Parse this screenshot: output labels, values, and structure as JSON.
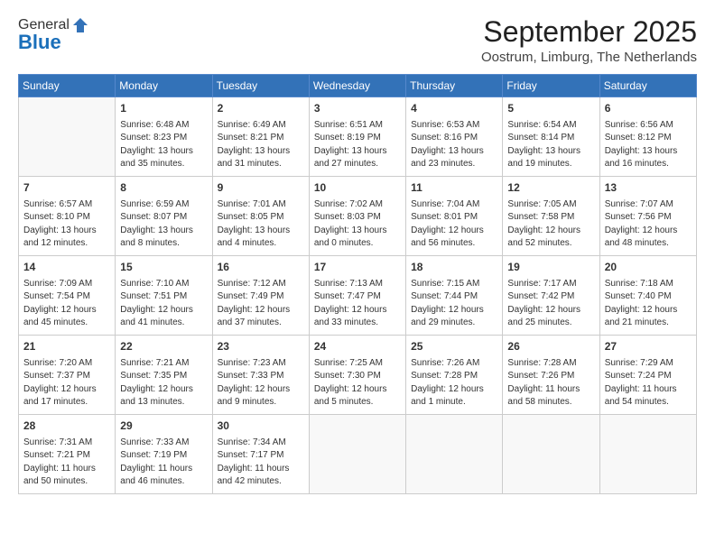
{
  "logo": {
    "general": "General",
    "blue": "Blue"
  },
  "header": {
    "month": "September 2025",
    "location": "Oostrum, Limburg, The Netherlands"
  },
  "days": [
    "Sunday",
    "Monday",
    "Tuesday",
    "Wednesday",
    "Thursday",
    "Friday",
    "Saturday"
  ],
  "weeks": [
    [
      {
        "day": "",
        "content": ""
      },
      {
        "day": "1",
        "content": "Sunrise: 6:48 AM\nSunset: 8:23 PM\nDaylight: 13 hours\nand 35 minutes."
      },
      {
        "day": "2",
        "content": "Sunrise: 6:49 AM\nSunset: 8:21 PM\nDaylight: 13 hours\nand 31 minutes."
      },
      {
        "day": "3",
        "content": "Sunrise: 6:51 AM\nSunset: 8:19 PM\nDaylight: 13 hours\nand 27 minutes."
      },
      {
        "day": "4",
        "content": "Sunrise: 6:53 AM\nSunset: 8:16 PM\nDaylight: 13 hours\nand 23 minutes."
      },
      {
        "day": "5",
        "content": "Sunrise: 6:54 AM\nSunset: 8:14 PM\nDaylight: 13 hours\nand 19 minutes."
      },
      {
        "day": "6",
        "content": "Sunrise: 6:56 AM\nSunset: 8:12 PM\nDaylight: 13 hours\nand 16 minutes."
      }
    ],
    [
      {
        "day": "7",
        "content": "Sunrise: 6:57 AM\nSunset: 8:10 PM\nDaylight: 13 hours\nand 12 minutes."
      },
      {
        "day": "8",
        "content": "Sunrise: 6:59 AM\nSunset: 8:07 PM\nDaylight: 13 hours\nand 8 minutes."
      },
      {
        "day": "9",
        "content": "Sunrise: 7:01 AM\nSunset: 8:05 PM\nDaylight: 13 hours\nand 4 minutes."
      },
      {
        "day": "10",
        "content": "Sunrise: 7:02 AM\nSunset: 8:03 PM\nDaylight: 13 hours\nand 0 minutes."
      },
      {
        "day": "11",
        "content": "Sunrise: 7:04 AM\nSunset: 8:01 PM\nDaylight: 12 hours\nand 56 minutes."
      },
      {
        "day": "12",
        "content": "Sunrise: 7:05 AM\nSunset: 7:58 PM\nDaylight: 12 hours\nand 52 minutes."
      },
      {
        "day": "13",
        "content": "Sunrise: 7:07 AM\nSunset: 7:56 PM\nDaylight: 12 hours\nand 48 minutes."
      }
    ],
    [
      {
        "day": "14",
        "content": "Sunrise: 7:09 AM\nSunset: 7:54 PM\nDaylight: 12 hours\nand 45 minutes."
      },
      {
        "day": "15",
        "content": "Sunrise: 7:10 AM\nSunset: 7:51 PM\nDaylight: 12 hours\nand 41 minutes."
      },
      {
        "day": "16",
        "content": "Sunrise: 7:12 AM\nSunset: 7:49 PM\nDaylight: 12 hours\nand 37 minutes."
      },
      {
        "day": "17",
        "content": "Sunrise: 7:13 AM\nSunset: 7:47 PM\nDaylight: 12 hours\nand 33 minutes."
      },
      {
        "day": "18",
        "content": "Sunrise: 7:15 AM\nSunset: 7:44 PM\nDaylight: 12 hours\nand 29 minutes."
      },
      {
        "day": "19",
        "content": "Sunrise: 7:17 AM\nSunset: 7:42 PM\nDaylight: 12 hours\nand 25 minutes."
      },
      {
        "day": "20",
        "content": "Sunrise: 7:18 AM\nSunset: 7:40 PM\nDaylight: 12 hours\nand 21 minutes."
      }
    ],
    [
      {
        "day": "21",
        "content": "Sunrise: 7:20 AM\nSunset: 7:37 PM\nDaylight: 12 hours\nand 17 minutes."
      },
      {
        "day": "22",
        "content": "Sunrise: 7:21 AM\nSunset: 7:35 PM\nDaylight: 12 hours\nand 13 minutes."
      },
      {
        "day": "23",
        "content": "Sunrise: 7:23 AM\nSunset: 7:33 PM\nDaylight: 12 hours\nand 9 minutes."
      },
      {
        "day": "24",
        "content": "Sunrise: 7:25 AM\nSunset: 7:30 PM\nDaylight: 12 hours\nand 5 minutes."
      },
      {
        "day": "25",
        "content": "Sunrise: 7:26 AM\nSunset: 7:28 PM\nDaylight: 12 hours\nand 1 minute."
      },
      {
        "day": "26",
        "content": "Sunrise: 7:28 AM\nSunset: 7:26 PM\nDaylight: 11 hours\nand 58 minutes."
      },
      {
        "day": "27",
        "content": "Sunrise: 7:29 AM\nSunset: 7:24 PM\nDaylight: 11 hours\nand 54 minutes."
      }
    ],
    [
      {
        "day": "28",
        "content": "Sunrise: 7:31 AM\nSunset: 7:21 PM\nDaylight: 11 hours\nand 50 minutes."
      },
      {
        "day": "29",
        "content": "Sunrise: 7:33 AM\nSunset: 7:19 PM\nDaylight: 11 hours\nand 46 minutes."
      },
      {
        "day": "30",
        "content": "Sunrise: 7:34 AM\nSunset: 7:17 PM\nDaylight: 11 hours\nand 42 minutes."
      },
      {
        "day": "",
        "content": ""
      },
      {
        "day": "",
        "content": ""
      },
      {
        "day": "",
        "content": ""
      },
      {
        "day": "",
        "content": ""
      }
    ]
  ]
}
